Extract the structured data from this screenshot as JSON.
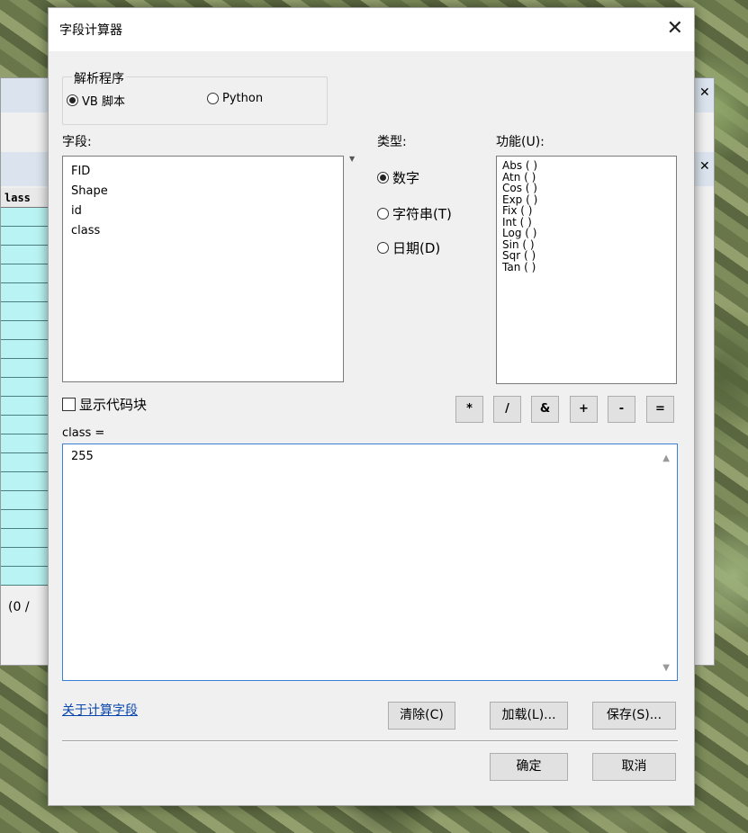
{
  "background": {
    "column_header": "lass",
    "status_text": "(0 /"
  },
  "dialog": {
    "title": "字段计算器",
    "close_glyph": "✕"
  },
  "parser": {
    "group_title": "解析程序",
    "options": [
      "VB 脚本",
      "Python"
    ],
    "selected": "VB 脚本"
  },
  "fields": {
    "label": "字段:",
    "items": [
      "FID",
      "Shape",
      "id",
      "class"
    ]
  },
  "type": {
    "label": "类型:",
    "options": [
      "数字",
      "字符串(T)",
      "日期(D)"
    ],
    "selected": "数字"
  },
  "functions": {
    "label": "功能(U):",
    "items": [
      "Abs ( )",
      "Atn ( )",
      "Cos ( )",
      "Exp ( )",
      "Fix ( )",
      "Int ( )",
      "Log ( )",
      "Sin ( )",
      "Sqr ( )",
      "Tan ( )"
    ]
  },
  "show_codeblock": {
    "label": "显示代码块",
    "checked": false
  },
  "operators": [
    "*",
    "/",
    "&",
    "+",
    "-",
    "="
  ],
  "expression": {
    "label": "class =",
    "value": "255"
  },
  "link": {
    "label": "关于计算字段"
  },
  "buttons": {
    "clear": "清除(C)",
    "load": "加载(L)...",
    "save": "保存(S)...",
    "ok": "确定",
    "cancel": "取消"
  },
  "colors": {
    "accent_border": "#3c7fd6",
    "link": "#0645ad",
    "table_cell": "#b9f3f3"
  }
}
